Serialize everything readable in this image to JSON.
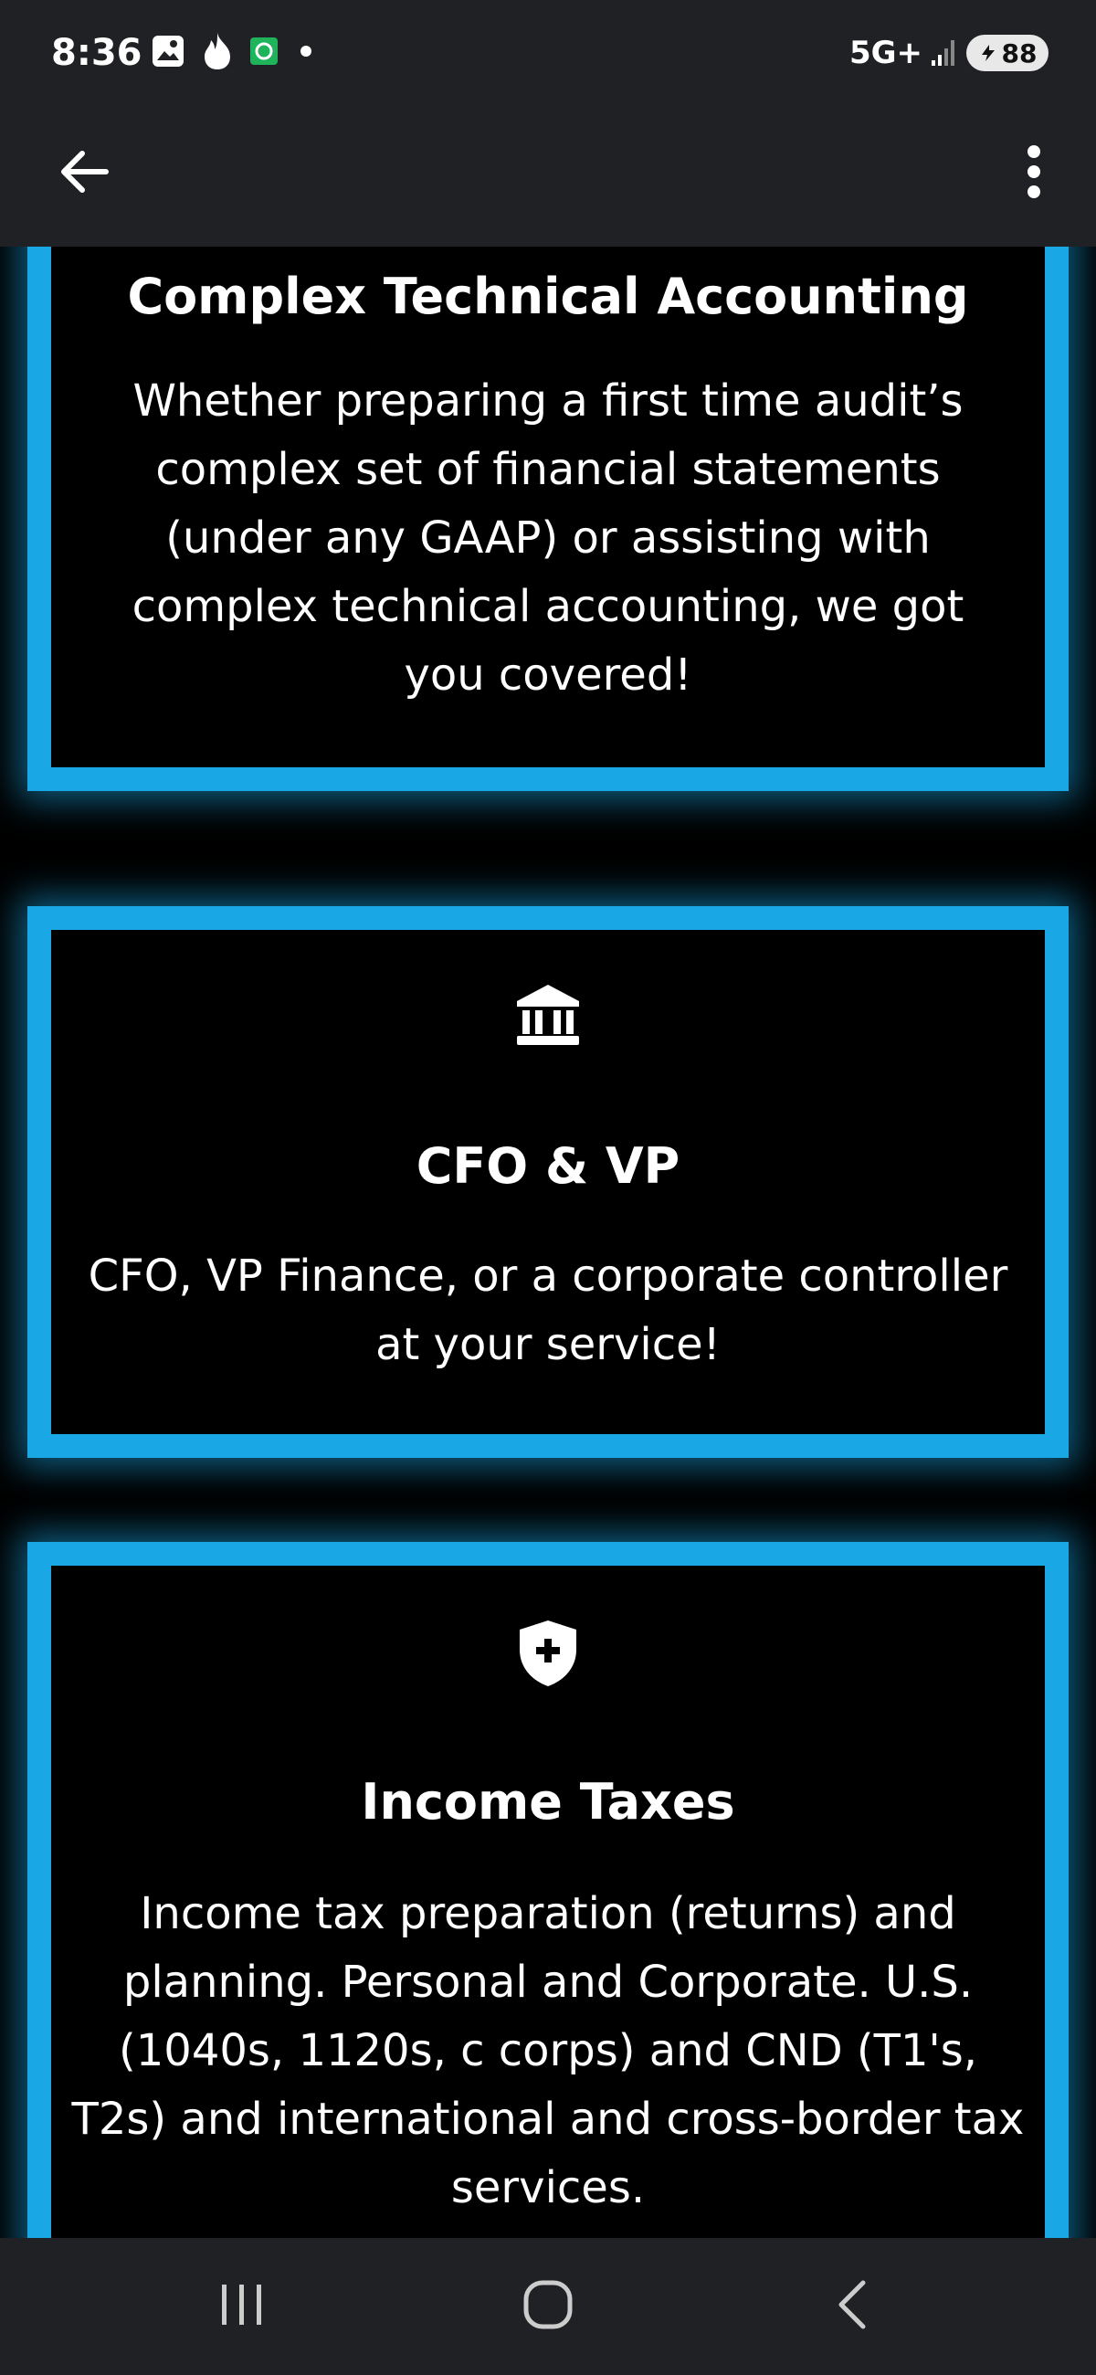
{
  "status_bar": {
    "time": "8:36",
    "network": "5G+",
    "battery": "88",
    "icons_left": [
      "gallery-icon",
      "flame-icon",
      "chat-app-icon",
      "dot-icon"
    ],
    "icons_right": [
      "signal-icon",
      "battery-icon"
    ]
  },
  "app_bar": {
    "back_icon": "arrow-left-icon",
    "menu_icon": "more-vert-icon"
  },
  "cards": [
    {
      "title": "Complex Technical Accounting",
      "text": "Whether preparing a first time audit’s complex set of financial statements (under any GAAP) or assisting with complex technical accounting, we got you covered!"
    },
    {
      "icon": "bank-icon",
      "title": "CFO & VP",
      "text": "CFO, VP Finance, or a corporate controller at your service!"
    },
    {
      "icon": "shield-plus-icon",
      "title": "Income Taxes",
      "text": "Income tax preparation (returns) and planning. Personal and Corporate. U.S. (1040s, 1120s, c corps) and CND (T1's, T2s) and international and cross-border tax services."
    }
  ],
  "colors": {
    "accent": "#19a7e6",
    "background": "#000000",
    "bars": "#202124"
  },
  "nav_bar": {
    "icons": [
      "recents-icon",
      "home-icon",
      "back-icon"
    ]
  }
}
